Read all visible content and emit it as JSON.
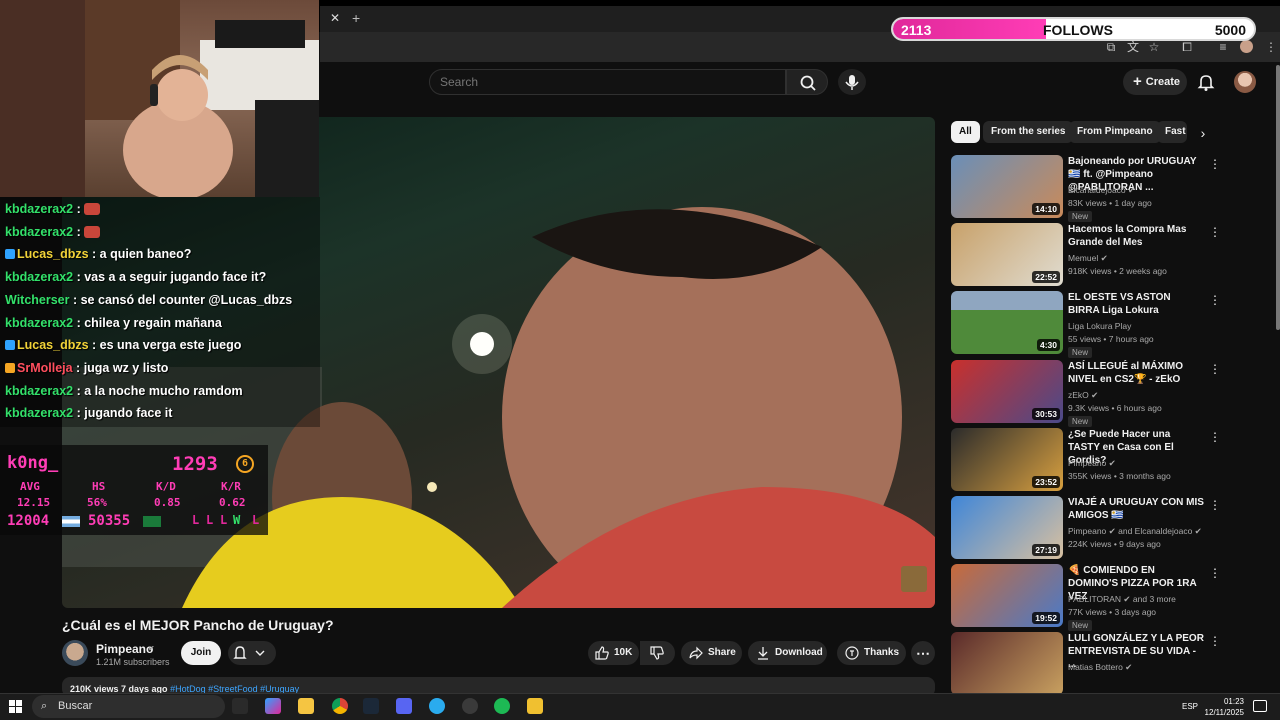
{
  "follows": {
    "current": "2113",
    "label": "FOLLOWS",
    "goal": "5000",
    "progress": 0.4226
  },
  "search": {
    "placeholder": "Search"
  },
  "header": {
    "create_label": "Create"
  },
  "video": {
    "title": "¿Cuál es el MEJOR Pancho de Uruguay?",
    "channel": "Pimpeano",
    "subscribers": "1.21M subscribers",
    "join_label": "Join",
    "likes": "10K",
    "share_label": "Share",
    "download_label": "Download",
    "thanks_label": "Thanks",
    "views_date": "210K views  7 days ago",
    "hashtags": "#HotDog #StreetFood #Uruguay"
  },
  "chat": [
    {
      "user": "kbdazerax2",
      "msg": "",
      "badge": "",
      "color": "#33e06a"
    },
    {
      "user": "kbdazerax2",
      "msg": "",
      "badge": "",
      "color": "#33e06a"
    },
    {
      "user": "Lucas_dbzs",
      "msg": "a quien baneo?",
      "badge": "mod",
      "color": "#f2d338"
    },
    {
      "user": "kbdazerax2",
      "msg": "vas a a seguir jugando face it?",
      "badge": "",
      "color": "#33e06a"
    },
    {
      "user": "Witcherser",
      "msg": "se cansó del counter @Lucas_dbzs",
      "badge": "",
      "color": "#33e06a"
    },
    {
      "user": "kbdazerax2",
      "msg": "chilea y regain mañana",
      "badge": "",
      "color": "#33e06a"
    },
    {
      "user": "Lucas_dbzs",
      "msg": "es una verga este juego",
      "badge": "mod",
      "color": "#f2d338"
    },
    {
      "user": "SrMolleja",
      "msg": "juga wz y listo",
      "badge": "sub",
      "color": "#ff4f5e"
    },
    {
      "user": "kbdazerax2",
      "msg": "a la noche mucho ramdom",
      "badge": "",
      "color": "#33e06a"
    },
    {
      "user": "kbdazerax2",
      "msg": "jugando face it",
      "badge": "",
      "color": "#33e06a"
    }
  ],
  "stats": {
    "player": "k0ng_",
    "elo": "1293",
    "level": "6",
    "headers": [
      "AVG",
      "HS",
      "K/D",
      "K/R"
    ],
    "values": [
      "12.15",
      "56%",
      "0.85",
      "0.62"
    ],
    "elo_a": "12004",
    "elo_b": "50355",
    "results": [
      "L",
      "L",
      "L",
      "W",
      "L"
    ]
  },
  "chips": [
    "All",
    "From the series",
    "From Pimpeano",
    "Fast"
  ],
  "recommendations": [
    {
      "title": "Bajoneando por URUGUAY 🇺🇾 ft. @Pimpeano @PABLITORAN ...",
      "channel": "Elcanaldejoaco ✔",
      "meta": "83K views • 1 day ago",
      "badge": "New",
      "duration": "14:10"
    },
    {
      "title": "Hacemos la Compra Mas Grande del Mes",
      "channel": "Memuel ✔",
      "meta": "918K views • 2 weeks ago",
      "badge": "",
      "duration": "22:52"
    },
    {
      "title": "EL OESTE VS ASTON BIRRA Liga Lokura",
      "channel": "Liga Lokura Play",
      "meta": "55 views • 7 hours ago",
      "badge": "New",
      "duration": "4:30"
    },
    {
      "title": "ASÍ LLEGUÉ al MÁXIMO NIVEL en CS2🏆 - zEkO",
      "channel": "zEkO ✔",
      "meta": "9.3K views • 6 hours ago",
      "badge": "New",
      "duration": "30:53"
    },
    {
      "title": "¿Se Puede Hacer una TASTY en Casa con El Gordis?",
      "channel": "Pimpeano ✔",
      "meta": "355K views • 3 months ago",
      "badge": "",
      "duration": "23:52"
    },
    {
      "title": "VIAJÉ A URUGUAY CON MIS AMIGOS 🇺🇾",
      "channel": "Pimpeano ✔ and Elcanaldejoaco ✔",
      "meta": "224K views • 9 days ago",
      "badge": "",
      "duration": "27:19"
    },
    {
      "title": "🍕 COMIENDO EN DOMINO'S PIZZA POR 1RA VEZ",
      "channel": "PABLITORAN ✔ and 3 more",
      "meta": "77K views • 3 days ago",
      "badge": "New",
      "duration": "19:52"
    },
    {
      "title": "LULI GONZÁLEZ Y LA PEOR ENTREVISTA DE SU VIDA - ...",
      "channel": "Matias Bottero ✔",
      "meta": "",
      "badge": "",
      "duration": ""
    }
  ],
  "taskbar": {
    "search_label": "Buscar",
    "lang": "ESP",
    "time": "01:23",
    "date": "12/11/2025"
  },
  "colors": {
    "accent_pink": "#e0289a",
    "yt_bg": "#0f0f0f",
    "chat_green": "#33e06a",
    "stats_pink": "#ff3db6"
  }
}
